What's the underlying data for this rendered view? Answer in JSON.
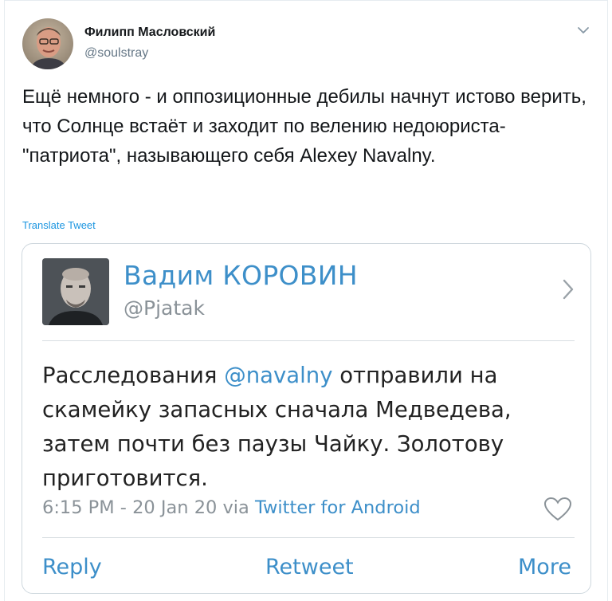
{
  "author": {
    "name": "Филипп Масловский",
    "handle": "@soulstray"
  },
  "tweet_text": "Ещё немного - и оппозиционные дебилы начнут истово верить, что Солнце встаёт и заходит по велению недоюриста-\"патриота\", называющего себя Alexey Navalny.",
  "translate_label": "Translate Tweet",
  "quoted": {
    "name": "Вадим КОРОВИН",
    "handle": "@Pjatak",
    "text_before": "Расследования ",
    "mention": "@navalny",
    "text_after": " отправили на скамейку запасных сначала Медведева, затем почти без паузы Чайку. Золотову приготовится.",
    "meta_time": "6:15 PM - 20 Jan 20 via ",
    "meta_source": "Twitter for Android",
    "actions": {
      "reply": "Reply",
      "retweet": "Retweet",
      "more": "More"
    }
  },
  "icons": {
    "caret": "chevron-down-icon",
    "quote_chevron": "chevron-right-icon",
    "heart": "heart-icon"
  },
  "colors": {
    "link": "#1b95e0",
    "quote_accent": "#3d8fc9",
    "secondary_text": "#657786"
  }
}
